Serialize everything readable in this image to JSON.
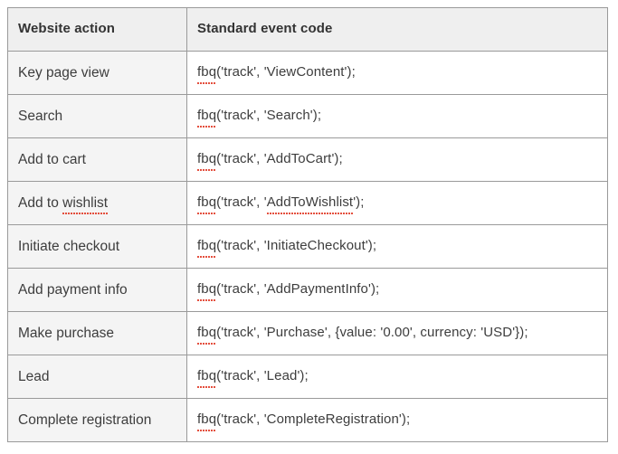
{
  "table": {
    "columns": [
      {
        "key": "action",
        "label": "Website action"
      },
      {
        "key": "code",
        "label": "Standard event code"
      }
    ],
    "rows": [
      {
        "action_prefix": "Key page view",
        "action_misspelled": "",
        "action_suffix": "",
        "code_fn": "fbq",
        "code_rest": "('track', 'ViewContent');",
        "code_rest_pre": "('track', '",
        "code_misspelled": "",
        "code_rest_post": ""
      },
      {
        "action_prefix": "Search",
        "action_misspelled": "",
        "action_suffix": "",
        "code_fn": "fbq",
        "code_rest": "('track', 'Search');",
        "code_rest_pre": "",
        "code_misspelled": "",
        "code_rest_post": ""
      },
      {
        "action_prefix": "Add to cart",
        "action_misspelled": "",
        "action_suffix": "",
        "code_fn": "fbq",
        "code_rest": "('track', 'AddToCart');",
        "code_rest_pre": "",
        "code_misspelled": "",
        "code_rest_post": ""
      },
      {
        "action_prefix": "Add to ",
        "action_misspelled": "wishlist",
        "action_suffix": "",
        "code_fn": "fbq",
        "code_rest": "",
        "code_rest_pre": "('track', '",
        "code_misspelled": "AddToWishlist",
        "code_rest_post": "');"
      },
      {
        "action_prefix": "Initiate checkout",
        "action_misspelled": "",
        "action_suffix": "",
        "code_fn": "fbq",
        "code_rest": "('track', 'InitiateCheckout');",
        "code_rest_pre": "",
        "code_misspelled": "",
        "code_rest_post": ""
      },
      {
        "action_prefix": "Add payment info",
        "action_misspelled": "",
        "action_suffix": "",
        "code_fn": "fbq",
        "code_rest": "('track', 'AddPaymentInfo');",
        "code_rest_pre": "",
        "code_misspelled": "",
        "code_rest_post": ""
      },
      {
        "action_prefix": "Make purchase",
        "action_misspelled": "",
        "action_suffix": "",
        "code_fn": "fbq",
        "code_rest": "('track', 'Purchase', {value: '0.00', currency: 'USD'});",
        "code_rest_pre": "",
        "code_misspelled": "",
        "code_rest_post": ""
      },
      {
        "action_prefix": "Lead",
        "action_misspelled": "",
        "action_suffix": "",
        "code_fn": "fbq",
        "code_rest": "('track', 'Lead');",
        "code_rest_pre": "",
        "code_misspelled": "",
        "code_rest_post": ""
      },
      {
        "action_prefix": "Complete registration",
        "action_misspelled": "",
        "action_suffix": "",
        "code_fn": "fbq",
        "code_rest": "('track', 'CompleteRegistration');",
        "code_rest_pre": "",
        "code_misspelled": "",
        "code_rest_post": ""
      }
    ]
  },
  "colors": {
    "header_background": "#efefef",
    "action_cell_background": "#f4f4f4",
    "code_cell_background": "#ffffff",
    "border": "#9a9a9a",
    "text": "#3d3d3d",
    "spellcheck_underline": "#e2412e"
  }
}
